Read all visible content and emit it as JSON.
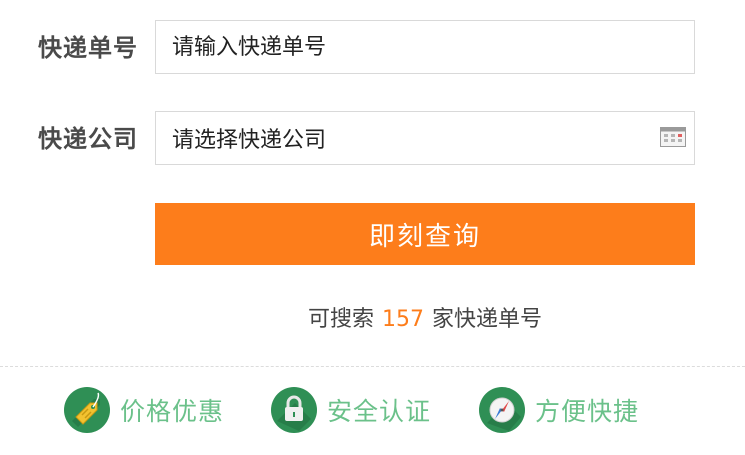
{
  "form": {
    "tracking_label": "快递单号",
    "tracking_placeholder": "请输入快递单号",
    "company_label": "快递公司",
    "company_placeholder": "请选择快递公司",
    "query_button": "即刻查询"
  },
  "count_line": {
    "prefix": "可搜索",
    "count": "157",
    "suffix": "家快递单号"
  },
  "features": [
    {
      "label": "价格优惠",
      "icon": "price-tag-icon"
    },
    {
      "label": "安全认证",
      "icon": "lock-icon"
    },
    {
      "label": "方便快捷",
      "icon": "compass-icon"
    }
  ],
  "colors": {
    "accent": "#fd7d1b",
    "feature_text": "#6bc18a",
    "badge_green": "#2e8b57"
  }
}
